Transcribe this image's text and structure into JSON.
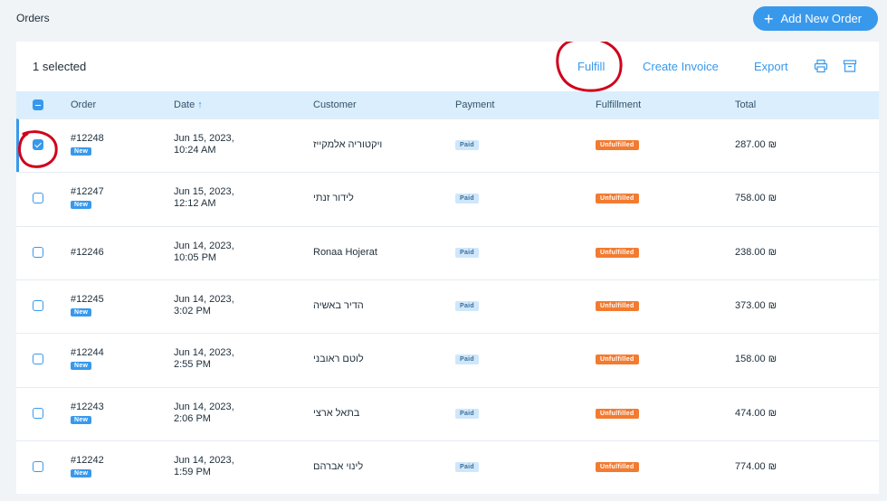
{
  "header": {
    "title": "Orders",
    "add_button_label": "Add New Order"
  },
  "toolbar": {
    "selected_text": "1 selected",
    "fulfill_label": "Fulfill",
    "create_invoice_label": "Create Invoice",
    "export_label": "Export",
    "print_icon": "print-icon",
    "archive_icon": "archive-icon"
  },
  "table": {
    "columns": [
      "Order",
      "Date",
      "Customer",
      "Payment",
      "Fulfillment",
      "Total"
    ],
    "sort_indicator": "↑",
    "rows": [
      {
        "order": "#12248",
        "badge": "New",
        "date1": "Jun 15, 2023,",
        "date2": "10:24 AM",
        "customer": "ויקטוריה אלמקייז",
        "payment": "Paid",
        "fulfillment": "Unfulfilled",
        "total": "287.00 ₪",
        "checked": true
      },
      {
        "order": "#12247",
        "badge": "New",
        "date1": "Jun 15, 2023,",
        "date2": "12:12 AM",
        "customer": "לידור זנתי",
        "payment": "Paid",
        "fulfillment": "Unfulfilled",
        "total": "758.00 ₪",
        "checked": false
      },
      {
        "order": "#12246",
        "badge": "",
        "date1": "Jun 14, 2023,",
        "date2": "10:05 PM",
        "customer": "Ronaa Hojerat",
        "payment": "Paid",
        "fulfillment": "Unfulfilled",
        "total": "238.00 ₪",
        "checked": false
      },
      {
        "order": "#12245",
        "badge": "New",
        "date1": "Jun 14, 2023,",
        "date2": "3:02 PM",
        "customer": "הדיר באשיה",
        "payment": "Paid",
        "fulfillment": "Unfulfilled",
        "total": "373.00 ₪",
        "checked": false
      },
      {
        "order": "#12244",
        "badge": "New",
        "date1": "Jun 14, 2023,",
        "date2": "2:55 PM",
        "customer": "לוטם ראובני",
        "payment": "Paid",
        "fulfillment": "Unfulfilled",
        "total": "158.00 ₪",
        "checked": false
      },
      {
        "order": "#12243",
        "badge": "New",
        "date1": "Jun 14, 2023,",
        "date2": "2:06 PM",
        "customer": "בתאל ארצי",
        "payment": "Paid",
        "fulfillment": "Unfulfilled",
        "total": "474.00 ₪",
        "checked": false
      },
      {
        "order": "#12242",
        "badge": "New",
        "date1": "Jun 14, 2023,",
        "date2": "1:59 PM",
        "customer": "לינוי אברהם",
        "payment": "Paid",
        "fulfillment": "Unfulfilled",
        "total": "774.00 ₪",
        "checked": false
      }
    ]
  },
  "colors": {
    "accent": "#3899ec",
    "unfulfilled": "#f27b30",
    "annotation": "#d0021b"
  }
}
